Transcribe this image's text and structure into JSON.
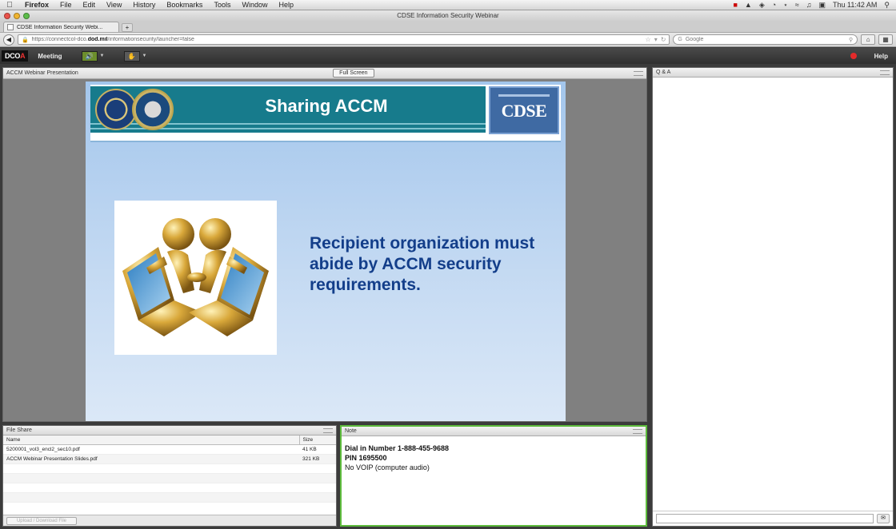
{
  "menubar": {
    "app": "Firefox",
    "items": [
      "File",
      "Edit",
      "View",
      "History",
      "Bookmarks",
      "Tools",
      "Window",
      "Help"
    ],
    "clock": "Thu 11:42 AM"
  },
  "browser": {
    "window_title": "CDSE Information Security Webinar",
    "tab_label": "CDSE Information Security Webi...",
    "url_prefix": "https://connectcol-dco.",
    "url_domain": "dod.mil",
    "url_suffix": "/informationsecurity/launcher=false",
    "search_placeholder": "Google"
  },
  "app_toolbar": {
    "logo_main": "DCO",
    "logo_accent": "A",
    "meeting_label": "Meeting",
    "help_label": "Help"
  },
  "share_pod": {
    "title": "ACCM Webinar Presentation",
    "fullscreen_label": "Full Screen"
  },
  "slide": {
    "title": "Sharing ACCM",
    "brand": "CDSE",
    "body_text": "Recipient organization must abide by ACCM security requirements."
  },
  "file_share": {
    "title": "File Share",
    "columns": [
      "Name",
      "Size"
    ],
    "rows": [
      {
        "name": "5200001_vol3_encl2_sec10.pdf",
        "size": "41 KB"
      },
      {
        "name": "ACCM Webinar Presentation Slides.pdf",
        "size": "321 KB"
      }
    ],
    "footer_button": "Upload / Download File"
  },
  "note": {
    "title": "Note",
    "line1": "Dial in Number 1-888-455-9688",
    "line2": "PIN 1695500",
    "line3": "No VOIP (computer audio)"
  },
  "qa": {
    "title": "Q & A"
  },
  "colors": {
    "slide_band": "#177b8c",
    "slide_text": "#133e8a",
    "note_border": "#5dbb3c",
    "record_dot": "#e42a2a"
  }
}
